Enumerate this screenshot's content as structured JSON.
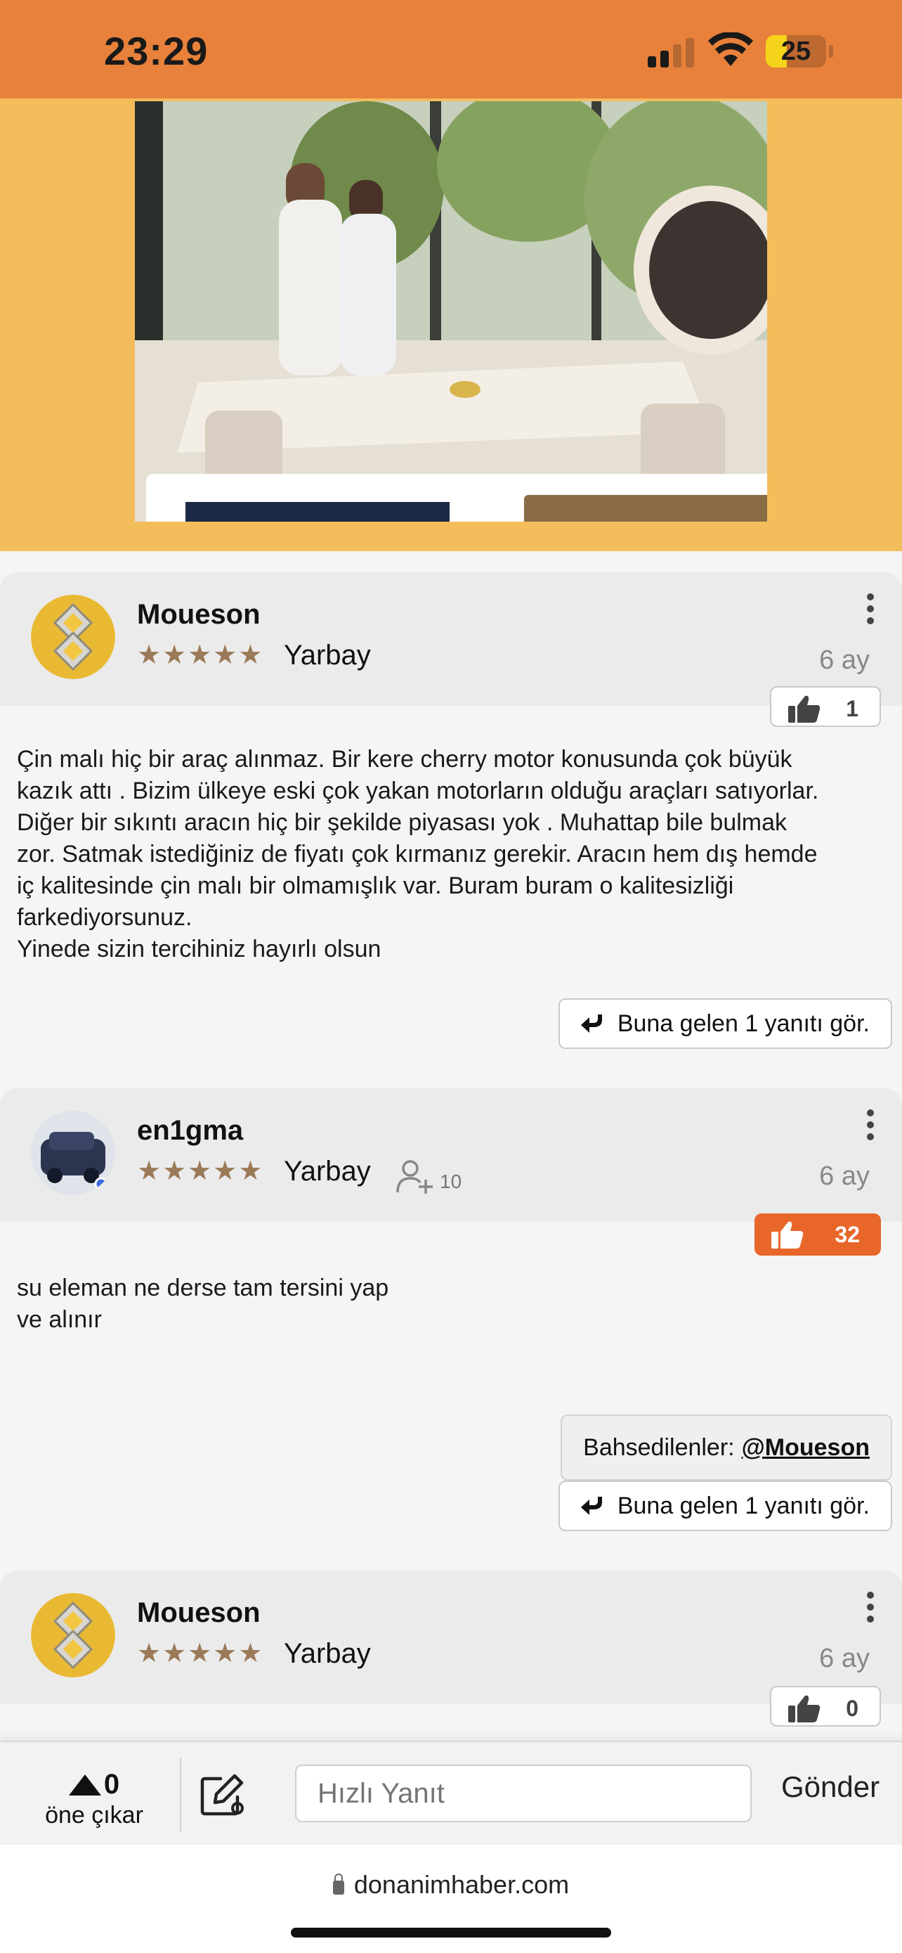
{
  "status_bar": {
    "time": "23:29",
    "battery": "25"
  },
  "comments": [
    {
      "username": "Moueson",
      "rank": "Yarbay",
      "date": "6 ay",
      "likes": "1",
      "liked": false,
      "text_lines": [
        "Çin malı hiç bir araç alınmaz. Bir kere cherry motor konusunda çok büyük",
        "kazık attı . Bizim ülkeye eski çok yakan motorların olduğu araçları satıyorlar.",
        "Diğer bir sıkıntı aracın hiç bir şekilde piyasası yok . Muhattap bile bulmak",
        "zor. Satmak istediğiniz de fiyatı çok kırmanız gerekir. Aracın hem dış hemde",
        "iç kalitesinde çin malı bir olmamışlık var. Buram buram o kalitesizliği",
        "farkediyorsunuz.",
        "Yinede sizin tercihiniz hayırlı olsun"
      ],
      "replies_label": "Buna gelen 1 yanıtı gör."
    },
    {
      "username": "en1gma",
      "rank": "Yarbay",
      "followers": "10",
      "date": "6 ay",
      "likes": "32",
      "liked": true,
      "text_lines": [
        "su eleman ne derse tam tersini yap",
        "ve alınır"
      ],
      "mentions_label": "Bahsedilenler:",
      "mention": "@Moueson",
      "replies_label": "Buna gelen 1 yanıtı gör."
    },
    {
      "username": "Moueson",
      "rank": "Yarbay",
      "date": "6 ay",
      "likes": "0",
      "liked": false
    }
  ],
  "bottom_bar": {
    "upvote_count": "0",
    "upvote_label": "öne çıkar",
    "quick_reply_placeholder": "Hızlı Yanıt",
    "send_label": "Gönder"
  },
  "url_bar": {
    "domain": "donanimhaber.com"
  },
  "colors": {
    "status_bar": "#e8813b",
    "ad_background": "#f3bd5c",
    "like_active": "#e8662a",
    "star": "#9b7a58"
  }
}
